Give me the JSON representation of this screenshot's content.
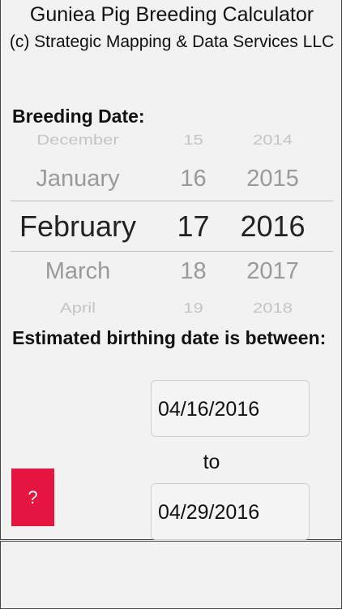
{
  "header": {
    "title": "Guniea Pig Breeding Calculator",
    "subtitle": "(c) Strategic Mapping & Data Services LLC"
  },
  "breeding": {
    "label": "Breeding Date:",
    "picker": {
      "rows": [
        {
          "month": "December",
          "day": "15",
          "year": "2014"
        },
        {
          "month": "January",
          "day": "16",
          "year": "2015"
        },
        {
          "month": "February",
          "day": "17",
          "year": "2016"
        },
        {
          "month": "March",
          "day": "18",
          "year": "2017"
        },
        {
          "month": "April",
          "day": "19",
          "year": "2018"
        }
      ]
    }
  },
  "estimate": {
    "label": "Estimated birthing date is between:",
    "start_date": "04/16/2016",
    "to_label": "to",
    "end_date": "04/29/2016"
  },
  "help_button": {
    "label": "?",
    "color": "#e6153f"
  }
}
